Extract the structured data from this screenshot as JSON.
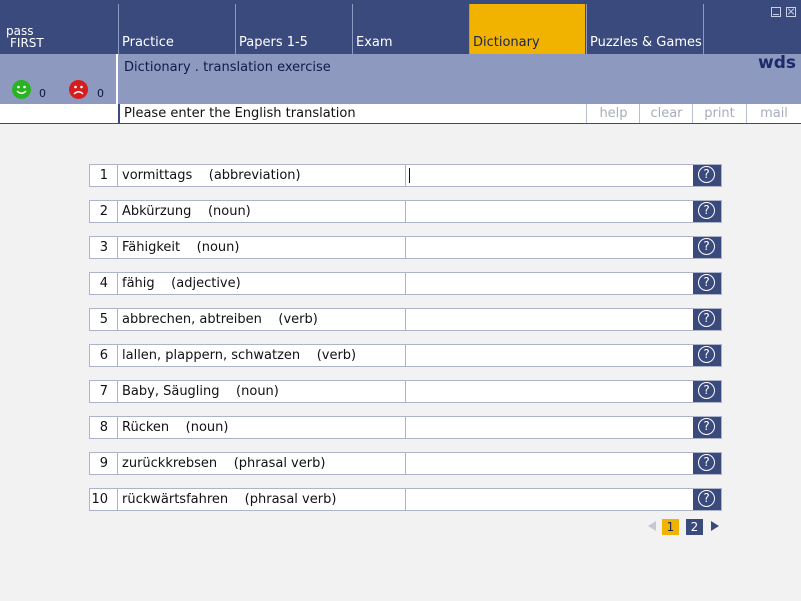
{
  "brand": {
    "line1": "pass",
    "line2": "FIRST"
  },
  "nav": {
    "tabs": [
      {
        "label": "Practice",
        "active": false
      },
      {
        "label": "Papers 1-5",
        "active": false
      },
      {
        "label": "Exam",
        "active": false
      },
      {
        "label": "Dictionary",
        "active": true
      },
      {
        "label": "Puzzles & Games",
        "active": false
      }
    ]
  },
  "score": {
    "correct": "0",
    "wrong": "0"
  },
  "header": {
    "exercise_title": "Dictionary . translation exercise",
    "logo": "wds"
  },
  "instruction": "Please enter the English translation",
  "toolbar": {
    "help": "help",
    "clear": "clear",
    "print": "print",
    "mail": "mail"
  },
  "exercise": {
    "items": [
      {
        "num": "1",
        "word": "vormittags    (abbreviation)",
        "answer": ""
      },
      {
        "num": "2",
        "word": "Abkürzung    (noun)",
        "answer": ""
      },
      {
        "num": "3",
        "word": "Fähigkeit    (noun)",
        "answer": ""
      },
      {
        "num": "4",
        "word": "fähig    (adjective)",
        "answer": ""
      },
      {
        "num": "5",
        "word": "abbrechen, abtreiben    (verb)",
        "answer": ""
      },
      {
        "num": "6",
        "word": "lallen, plappern, schwatzen    (verb)",
        "answer": ""
      },
      {
        "num": "7",
        "word": "Baby, Säugling    (noun)",
        "answer": ""
      },
      {
        "num": "8",
        "word": "Rücken    (noun)",
        "answer": ""
      },
      {
        "num": "9",
        "word": "zurückkrebsen    (phrasal verb)",
        "answer": ""
      },
      {
        "num": "10",
        "word": "rückwärtsfahren    (phrasal verb)",
        "answer": ""
      }
    ],
    "help_glyph": "?"
  },
  "pager": {
    "pages": [
      "1",
      "2"
    ],
    "current": "1"
  },
  "colors": {
    "navy": "#3b4a7c",
    "accent": "#f2b200",
    "band": "#8e99c0",
    "happy": "#2ab321",
    "sad": "#d51d1d"
  },
  "icons": {
    "happy": "smiley-icon",
    "sad": "frowny-icon",
    "help": "question-circle-icon",
    "prev": "triangle-left-icon",
    "next": "triangle-right-icon"
  }
}
